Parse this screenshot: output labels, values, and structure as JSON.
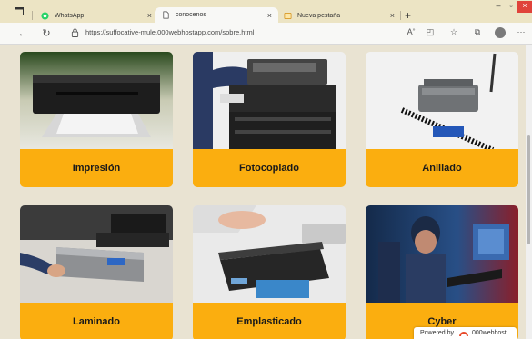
{
  "tabs": [
    {
      "title": "WhatsApp",
      "close": "×",
      "active": false
    },
    {
      "title": "conocenos",
      "close": "×",
      "active": true
    },
    {
      "title": "Nueva pestaña",
      "close": "×",
      "active": false
    }
  ],
  "newtab": "+",
  "address": {
    "url": "https://suffocative-mule.000webhostapp.com/sobre.html"
  },
  "services": [
    {
      "label": "Impresión"
    },
    {
      "label": "Fotocopiado"
    },
    {
      "label": "Anillado"
    },
    {
      "label": "Laminado"
    },
    {
      "label": "Emplasticado"
    },
    {
      "label": "Cyber"
    }
  ],
  "badge": {
    "powered": "Powered by",
    "host": "000webhost"
  },
  "colors": {
    "accent": "#fbae0f",
    "page_bg": "#e9e3d2",
    "tabbar": "#ece4c4"
  }
}
